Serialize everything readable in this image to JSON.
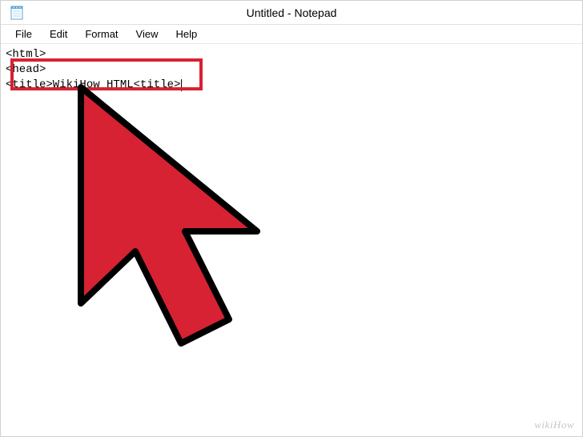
{
  "window": {
    "title": "Untitled - Notepad"
  },
  "menu": {
    "file": "File",
    "edit": "Edit",
    "format": "Format",
    "view": "View",
    "help": "Help"
  },
  "content": {
    "line1": "<html>",
    "line2": "<head>",
    "line3": "<title>WikiHow HTML<title>"
  },
  "watermark": "wikiHow"
}
